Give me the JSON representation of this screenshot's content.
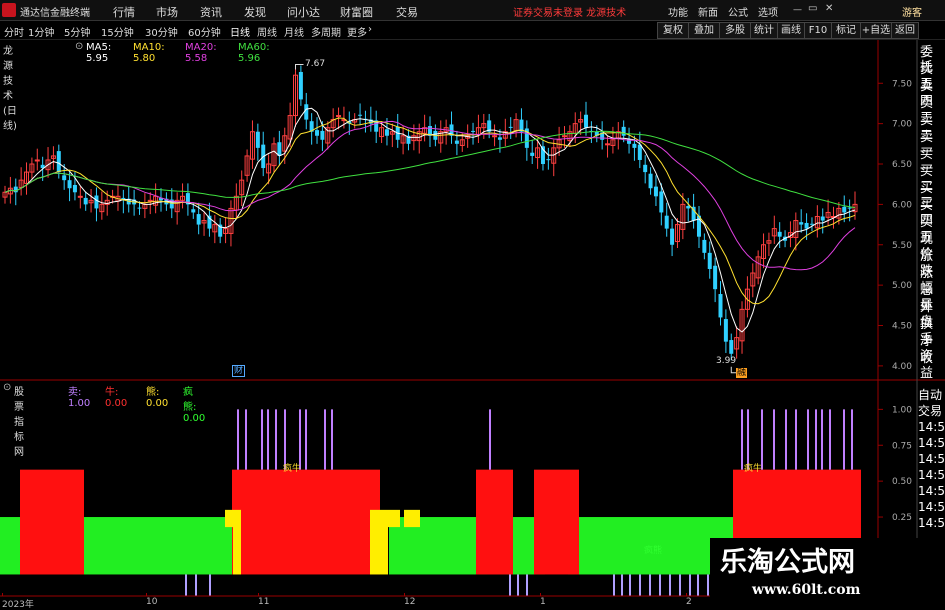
{
  "app": {
    "title": "通达信金融终端"
  },
  "menu": [
    "行情",
    "市场",
    "资讯",
    "发现",
    "问小达",
    "财富圈",
    "交易"
  ],
  "notice": "证券交易未登录  龙源技术",
  "right_menu": [
    "功能",
    "新面",
    "公式",
    "选项",
    "游客"
  ],
  "toolbar": {
    "periods": [
      "分时",
      "1分钟",
      "5分钟",
      "15分钟",
      "30分钟",
      "60分钟",
      "日线",
      "周线",
      "月线",
      "多周期",
      "更多"
    ],
    "right_buttons": [
      "复权",
      "叠加",
      "多股",
      "统计",
      "画线",
      "F10",
      "标记",
      "+自选",
      "返回"
    ]
  },
  "main_chart": {
    "title": "龙源技术(日线)",
    "ma": [
      {
        "label": "MA5: 5.95",
        "color": "#ffffff"
      },
      {
        "label": "MA10: 5.80",
        "color": "#ffe030"
      },
      {
        "label": "MA20: 5.58",
        "color": "#e040e0"
      },
      {
        "label": "MA60: 5.96",
        "color": "#40e040"
      }
    ],
    "high_label": "7.67",
    "low_label": "3.99",
    "badges": [
      "财",
      "融"
    ]
  },
  "sub_chart": {
    "title": "股票指标网",
    "indicators": [
      {
        "label": "卖: 1.00",
        "color": "#c080ff"
      },
      {
        "label": "牛: 0.00",
        "color": "#ff3030"
      },
      {
        "label": "熊: 0.00",
        "color": "#ffe030"
      },
      {
        "label": "疯熊: 0.00",
        "color": "#30ff30"
      }
    ],
    "region_labels": [
      "疯牛",
      "疯牛",
      "疯熊"
    ]
  },
  "right_panel": {
    "labels": [
      "委托",
      "卖五",
      "卖四",
      "卖三",
      "卖二",
      "卖一",
      "买一",
      "买二",
      "买三",
      "买四",
      "买五",
      "现价",
      "涨跌",
      "涨幅",
      "总量",
      "外盘",
      "换手",
      "净资",
      "收益"
    ],
    "lower": [
      "自动",
      "交易",
      "14:55",
      "14:55",
      "14:55",
      "14:56",
      "14:56",
      "14:56",
      "14:56"
    ]
  },
  "x_axis": [
    "2023年",
    "10",
    "11",
    "12",
    "1",
    "2"
  ],
  "watermark": {
    "line1": "乐淘公式网",
    "line2": "www.60lt.com"
  },
  "chart_data": [
    {
      "type": "candlestick",
      "title": "龙源技术(日线)",
      "y_ticks": [
        7.5,
        7.0,
        6.5,
        6.0,
        5.5,
        5.0,
        4.5,
        4.0
      ],
      "ylim": [
        3.85,
        7.85
      ],
      "x_ticks": [
        "2023年",
        "10",
        "11",
        "12",
        "1",
        "2"
      ],
      "grid": false,
      "annotations": [
        {
          "text": "7.67",
          "value": 7.67
        },
        {
          "text": "3.99",
          "value": 3.99
        }
      ],
      "closes": [
        6.15,
        6.2,
        6.15,
        6.3,
        6.4,
        6.5,
        6.55,
        6.45,
        6.55,
        6.6,
        6.4,
        6.3,
        6.2,
        6.15,
        6.1,
        6.0,
        6.05,
        5.95,
        6.0,
        6.05,
        6.1,
        6.1,
        6.05,
        6.0,
        6.0,
        5.95,
        6.0,
        6.05,
        6.1,
        6.05,
        6.0,
        5.95,
        6.05,
        6.1,
        6.0,
        5.9,
        5.75,
        5.8,
        5.7,
        5.75,
        5.6,
        5.7,
        5.95,
        6.1,
        6.3,
        6.6,
        6.9,
        6.7,
        6.45,
        6.5,
        6.75,
        6.6,
        6.85,
        7.1,
        7.6,
        7.3,
        7.05,
        6.9,
        6.85,
        6.8,
        6.95,
        7.05,
        7.1,
        7.05,
        7.0,
        7.05,
        7.1,
        7.05,
        7.0,
        6.9,
        6.95,
        6.85,
        6.9,
        6.8,
        6.85,
        6.75,
        6.85,
        6.9,
        6.95,
        6.85,
        6.8,
        6.9,
        6.95,
        6.85,
        6.75,
        6.8,
        6.85,
        6.9,
        6.95,
        7.0,
        6.9,
        6.85,
        6.8,
        6.9,
        6.95,
        7.05,
        6.9,
        6.7,
        6.6,
        6.7,
        6.5,
        6.55,
        6.7,
        6.8,
        6.85,
        6.9,
        7.0,
        7.05,
        6.95,
        6.9,
        6.85,
        6.8,
        6.75,
        6.8,
        6.9,
        6.85,
        6.75,
        6.7,
        6.55,
        6.4,
        6.2,
        6.1,
        5.9,
        5.7,
        5.5,
        5.75,
        6.0,
        5.95,
        5.8,
        5.6,
        5.4,
        5.2,
        4.95,
        4.6,
        4.3,
        4.15,
        4.35,
        4.7,
        4.95,
        5.15,
        5.35,
        5.5,
        5.55,
        5.7,
        5.6,
        5.55,
        5.65,
        5.8,
        5.75,
        5.7,
        5.75,
        5.85,
        5.8,
        5.9,
        5.85,
        5.95,
        5.9,
        5.95,
        6.0
      ]
    },
    {
      "type": "bar",
      "title": "股票指标网",
      "y_ticks": [
        1.0,
        0.75,
        0.5,
        0.25,
        0.0
      ],
      "ylim": [
        -0.3,
        1.1
      ],
      "series": [
        {
          "name": "卖",
          "color": "#c080ff"
        },
        {
          "name": "牛",
          "color": "#ff3030"
        },
        {
          "name": "熊",
          "color": "#ffe030"
        },
        {
          "name": "疯熊",
          "color": "#30ff30"
        }
      ],
      "segments": [
        {
          "color": "#30ff30",
          "from": 0,
          "to": 0.2
        },
        {
          "color": "#ff1a1a",
          "from": 0.2,
          "to": 0.75
        },
        {
          "color": "#ff1a1a",
          "from": 0.75,
          "to": 1.0
        }
      ]
    }
  ]
}
